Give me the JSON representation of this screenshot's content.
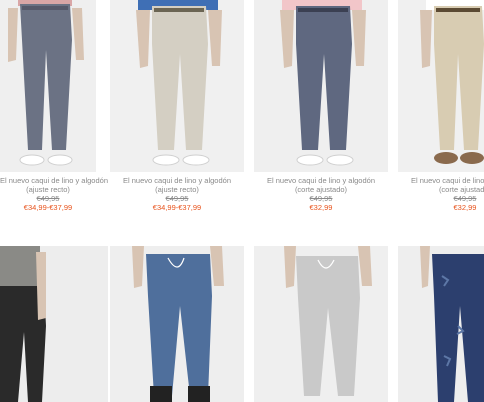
{
  "products_row1": [
    {
      "name_line1": "El nuevo caqui de lino y algodón",
      "name_line2": "(ajuste recto)",
      "old_price": "€49,95",
      "sale_price": "€34,99-€37,99",
      "pants_color": "#6b7284",
      "bg_color": "#efefef"
    },
    {
      "name_line1": "El nuevo caqui de lino y algodón",
      "name_line2": "(ajuste recto)",
      "old_price": "€49,95",
      "sale_price": "€34,99-€37,99",
      "pants_color": "#d4cfc3",
      "bg_color": "#f0f0f0"
    },
    {
      "name_line1": "El nuevo caqui de lino y algodón",
      "name_line2": "(corte ajustado)",
      "old_price": "€49,95",
      "sale_price": "€32,99",
      "pants_color": "#5f6880",
      "bg_color": "#efefef"
    },
    {
      "name_line1": "El nuevo caqui de lino y algodón",
      "name_line2": "(corte ajustado)",
      "old_price": "€49,95",
      "sale_price": "€32,99",
      "pants_color": "#d8ccb2",
      "bg_color": "#f0f0f0"
    }
  ],
  "products_row2": [
    {
      "pants_color": "#2a2a2a",
      "bg_color": "#ededed"
    },
    {
      "pants_color": "#4f6f9c",
      "bg_color": "#eeeeee"
    },
    {
      "pants_color": "#c9c9c9",
      "bg_color": "#efefef"
    },
    {
      "pants_color": "#2c3f6e",
      "bg_color": "#eeeeee"
    }
  ]
}
